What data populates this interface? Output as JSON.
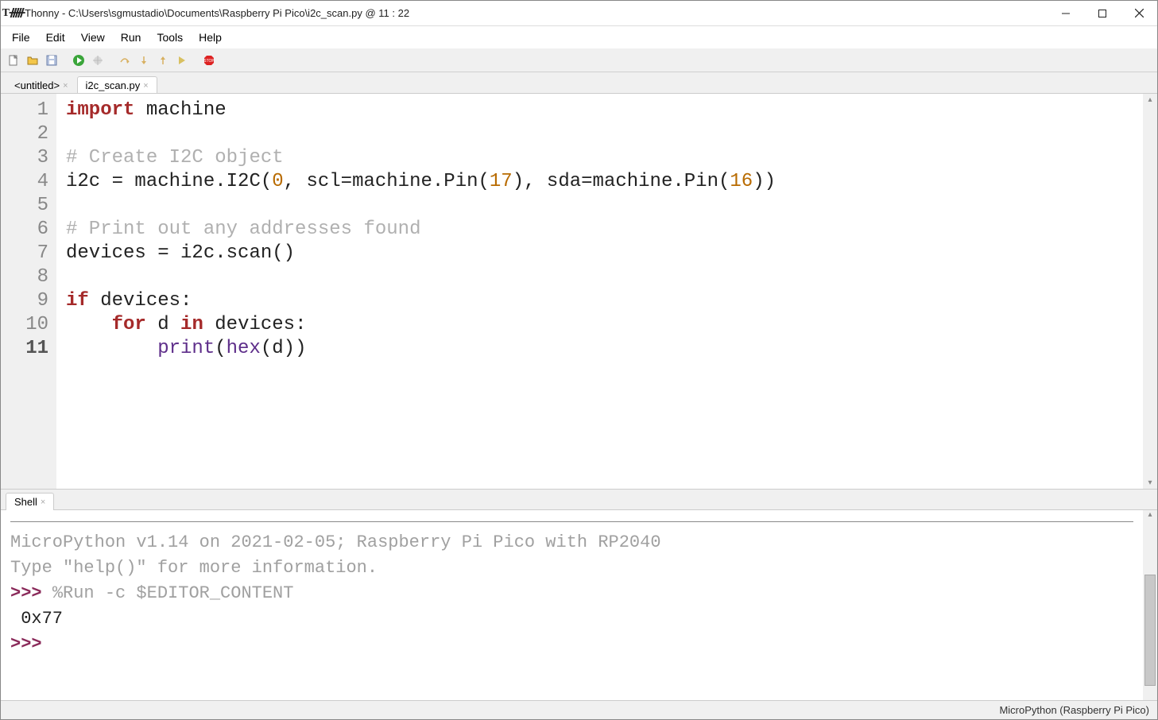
{
  "window": {
    "title": "Thonny  -  C:\\Users\\sgmustadio\\Documents\\Raspberry Pi Pico\\i2c_scan.py  @  11 : 22"
  },
  "menu": {
    "items": [
      "File",
      "Edit",
      "View",
      "Run",
      "Tools",
      "Help"
    ]
  },
  "toolbar": {
    "icons": [
      "new-file",
      "open-file",
      "save-file",
      "run",
      "debug",
      "step-over",
      "step-into",
      "step-out",
      "resume",
      "stop"
    ]
  },
  "tabs": {
    "items": [
      {
        "label": "<untitled>",
        "active": false
      },
      {
        "label": "i2c_scan.py",
        "active": true
      }
    ]
  },
  "editor": {
    "line_count": 11,
    "current_line": 11,
    "lines": [
      {
        "t": [
          [
            "kw",
            "import"
          ],
          [
            "",
            " machine"
          ]
        ]
      },
      {
        "t": [
          [
            "",
            ""
          ]
        ]
      },
      {
        "t": [
          [
            "cm",
            "# Create I2C object"
          ]
        ]
      },
      {
        "t": [
          [
            "",
            "i2c = machine.I2C("
          ],
          [
            "num",
            "0"
          ],
          [
            "",
            ", scl=machine.Pin("
          ],
          [
            "num",
            "17"
          ],
          [
            "",
            ")"
          ],
          [
            "",
            ", sda=machine.Pin("
          ],
          [
            "num",
            "16"
          ],
          [
            "",
            ")"
          ],
          [
            "",
            ")"
          ]
        ]
      },
      {
        "t": [
          [
            "",
            ""
          ]
        ]
      },
      {
        "t": [
          [
            "cm",
            "# Print out any addresses found"
          ]
        ]
      },
      {
        "t": [
          [
            "",
            "devices = i2c.scan()"
          ]
        ]
      },
      {
        "t": [
          [
            "",
            ""
          ]
        ]
      },
      {
        "t": [
          [
            "kw",
            "if"
          ],
          [
            "",
            " devices:"
          ]
        ]
      },
      {
        "t": [
          [
            "",
            "    "
          ],
          [
            "kw",
            "for"
          ],
          [
            "",
            " d "
          ],
          [
            "kw",
            "in"
          ],
          [
            "",
            " devices:"
          ]
        ]
      },
      {
        "t": [
          [
            "",
            "        "
          ],
          [
            "fn",
            "print"
          ],
          [
            "",
            "("
          ],
          [
            "fn",
            "hex"
          ],
          [
            "",
            "(d)"
          ],
          [
            "",
            ")"
          ]
        ]
      }
    ]
  },
  "shell": {
    "tab_label": "Shell",
    "banner1": "MicroPython v1.14 on 2021-02-05; Raspberry Pi Pico with RP2040",
    "banner2": "Type \"help()\" for more information.",
    "prompt": ">>> ",
    "run_cmd": "%Run -c $EDITOR_CONTENT",
    "output": " 0x77",
    "prompt2": ">>> "
  },
  "status": {
    "interpreter": "MicroPython (Raspberry Pi Pico)"
  }
}
